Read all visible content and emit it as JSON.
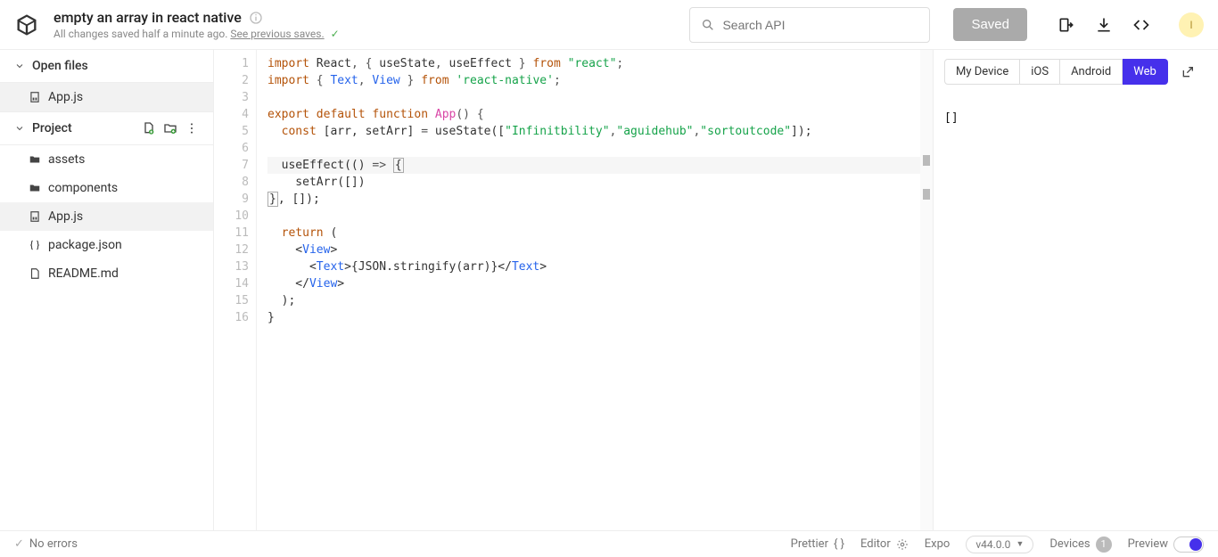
{
  "header": {
    "title": "empty an array in react native",
    "subtitle_prefix": "All changes saved half a minute ago. ",
    "subtitle_link": "See previous saves.",
    "search_placeholder": "Search API",
    "saved_label": "Saved",
    "avatar_initial": "I"
  },
  "sidebar": {
    "open_files_label": "Open files",
    "open_files": [
      "App.js"
    ],
    "project_label": "Project",
    "project_items": [
      {
        "name": "assets",
        "type": "folder"
      },
      {
        "name": "components",
        "type": "folder"
      },
      {
        "name": "App.js",
        "type": "js",
        "active": true
      },
      {
        "name": "package.json",
        "type": "json"
      },
      {
        "name": "README.md",
        "type": "md"
      }
    ]
  },
  "editor": {
    "line_count": 16,
    "lines": [
      {
        "n": 1,
        "tokens": [
          [
            "kw",
            "import"
          ],
          [
            "",
            " React"
          ],
          [
            "punct",
            ", { "
          ],
          [
            "",
            "useState"
          ],
          [
            "punct",
            ", "
          ],
          [
            "",
            "useEffect"
          ],
          [
            "punct",
            " } "
          ],
          [
            "kw",
            "from"
          ],
          [
            "",
            " "
          ],
          [
            "str",
            "\"react\""
          ],
          [
            "punct",
            ";"
          ]
        ]
      },
      {
        "n": 2,
        "tokens": [
          [
            "kw",
            "import"
          ],
          [
            "punct",
            " { "
          ],
          [
            "def",
            "Text"
          ],
          [
            "punct",
            ", "
          ],
          [
            "def",
            "View"
          ],
          [
            "punct",
            " } "
          ],
          [
            "kw",
            "from"
          ],
          [
            "",
            " "
          ],
          [
            "str",
            "'react-native'"
          ],
          [
            "punct",
            ";"
          ]
        ]
      },
      {
        "n": 3,
        "tokens": []
      },
      {
        "n": 4,
        "tokens": [
          [
            "kw",
            "export"
          ],
          [
            "",
            " "
          ],
          [
            "kw",
            "default"
          ],
          [
            "",
            " "
          ],
          [
            "kw",
            "function"
          ],
          [
            "",
            " "
          ],
          [
            "fn",
            "App"
          ],
          [
            "punct",
            "() {"
          ]
        ]
      },
      {
        "n": 5,
        "tokens": [
          [
            "",
            "  "
          ],
          [
            "kw",
            "const"
          ],
          [
            "",
            " [arr, setArr] "
          ],
          [
            "punct",
            "= "
          ],
          [
            "",
            "useState(["
          ],
          [
            "str",
            "\"Infinitbility\""
          ],
          [
            "punct",
            ","
          ],
          [
            "str",
            "\"aguidehub\""
          ],
          [
            "punct",
            ","
          ],
          [
            "str",
            "\"sortoutcode\""
          ],
          [
            "",
            "]);"
          ]
        ]
      },
      {
        "n": 6,
        "tokens": []
      },
      {
        "n": 7,
        "hl": true,
        "tokens": [
          [
            "",
            "  useEffect(() "
          ],
          [
            "punct",
            "=>"
          ],
          [
            "",
            " "
          ],
          [
            "box",
            "{"
          ]
        ]
      },
      {
        "n": 8,
        "tokens": [
          [
            "",
            "    setArr([])"
          ]
        ]
      },
      {
        "n": 9,
        "tokens": [
          [
            "box",
            "}"
          ],
          [
            "",
            ", []);"
          ]
        ]
      },
      {
        "n": 10,
        "tokens": []
      },
      {
        "n": 11,
        "tokens": [
          [
            "",
            "  "
          ],
          [
            "kw",
            "return"
          ],
          [
            "",
            " ("
          ]
        ]
      },
      {
        "n": 12,
        "tokens": [
          [
            "",
            "    <"
          ],
          [
            "tag",
            "View"
          ],
          [
            "",
            ">"
          ]
        ]
      },
      {
        "n": 13,
        "tokens": [
          [
            "",
            "      <"
          ],
          [
            "tag",
            "Text"
          ],
          [
            "",
            ">{JSON.stringify(arr)}</"
          ],
          [
            "tag",
            "Text"
          ],
          [
            "",
            ">"
          ]
        ]
      },
      {
        "n": 14,
        "tokens": [
          [
            "",
            "    </"
          ],
          [
            "tag",
            "View"
          ],
          [
            "",
            ">"
          ]
        ]
      },
      {
        "n": 15,
        "tokens": [
          [
            "",
            "  );"
          ]
        ]
      },
      {
        "n": 16,
        "tokens": [
          [
            "",
            "}"
          ]
        ]
      }
    ]
  },
  "preview": {
    "tabs": [
      "My Device",
      "iOS",
      "Android",
      "Web"
    ],
    "active_tab": "Web",
    "output": "[]"
  },
  "statusbar": {
    "no_errors": "No errors",
    "prettier": "Prettier",
    "editor": "Editor",
    "expo": "Expo",
    "version": "v44.0.0",
    "devices": "Devices",
    "devices_count": "1",
    "preview": "Preview"
  }
}
